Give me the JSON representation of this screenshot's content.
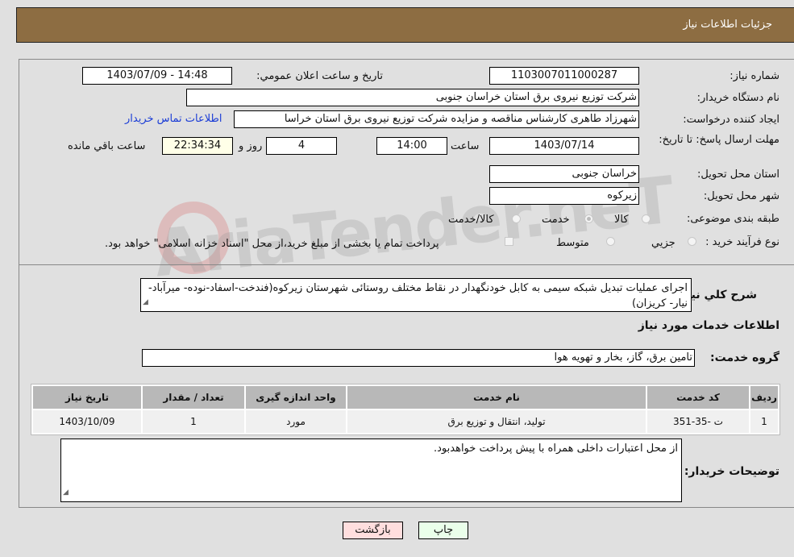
{
  "header": {
    "title": "جزئیات اطلاعات نیاز"
  },
  "form": {
    "need_number_label": "شماره نیاز:",
    "need_number": "1103007011000287",
    "announce_label": "تاریخ و ساعت اعلان عمومي:",
    "announce_value": "1403/07/09 - 14:48",
    "buyer_org_label": "نام دستگاه خریدار:",
    "buyer_org": "شرکت توزیع نیروی برق استان خراسان جنوبی",
    "creator_label": "ایجاد کننده درخواست:",
    "creator": "شهرزاد طاهری کارشناس مناقصه و مزایده شرکت توزیع نیروی برق استان خراسا",
    "contact_link": "اطلاعات تماس خریدار",
    "deadline_label": "مهلت ارسال پاسخ: تا تاریخ:",
    "deadline_date": "1403/07/14",
    "time_label": "ساعت",
    "deadline_time": "14:00",
    "days_value": "4",
    "days_label": "روز و",
    "remaining_time": "22:34:34",
    "remaining_label": "ساعت باقي مانده",
    "province_label": "استان محل تحویل:",
    "province": "خراسان جنوبی",
    "city_label": "شهر محل تحویل:",
    "city": "زیرکوه",
    "category_label": "طبقه بندی موضوعی:",
    "category_options": [
      "کالا",
      "خدمت",
      "کالا/خدمت"
    ],
    "category_selected": "خدمت",
    "process_label": "نوع فرآیند خرید :",
    "process_options": [
      "جزيي",
      "متوسط"
    ],
    "treasury_note": "پرداخت تمام یا بخشی از مبلغ خرید،از محل \"اسناد خزانه اسلامی\" خواهد بود."
  },
  "details": {
    "description_label": "شرح كلي نياز:",
    "description": "اجرای عملیات تبدیل شبکه سیمی به کابل خودنگهدار در نقاط مختلف روستائی شهرستان زیرکوه(فندخت-اسفاد-نوده- میرآباد-نیار- کریزان)",
    "services_heading": "اطلاعات خدمات مورد نیاز",
    "service_group_label": "گروه خدمت:",
    "service_group": "تامین برق، گاز، بخار و تهویه هوا",
    "table": {
      "headers": [
        "ردیف",
        "کد خدمت",
        "نام خدمت",
        "واحد اندازه گیری",
        "تعداد / مقدار",
        "تاریخ نیاز"
      ],
      "rows": [
        [
          "1",
          "ت -35-351",
          "تولید، انتقال و توزیع برق",
          "مورد",
          "1",
          "1403/10/09"
        ]
      ]
    },
    "buyer_notes_label": "توضیحات خریدار:",
    "buyer_notes": "از محل اعتبارات داخلی همراه با پیش پرداخت خواهدبود."
  },
  "buttons": {
    "print": "چاپ",
    "back": "بازگشت"
  },
  "watermark": "AriaTender.neT"
}
